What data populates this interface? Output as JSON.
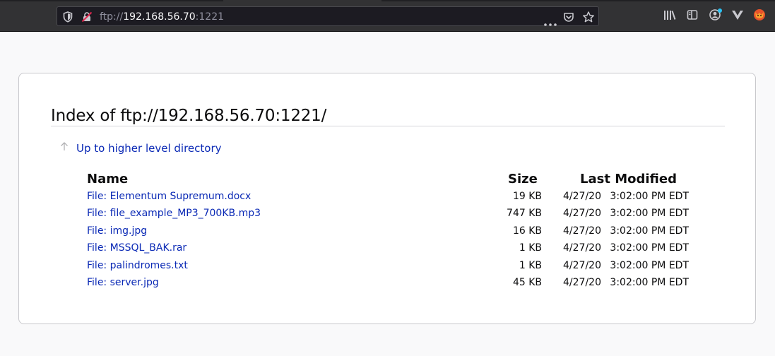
{
  "toolbar": {
    "url_scheme": "ftp://",
    "url_host": "192.168.56.70",
    "url_port": ":1221",
    "icons": [
      "shield-icon",
      "insecure-lock-icon",
      "page-actions-icon",
      "pocket-icon",
      "bookmark-star-icon",
      "library-icon",
      "sidebar-icon",
      "account-icon",
      "extension-v-icon",
      "fox-extension-icon"
    ],
    "colors": {
      "background": "#323234",
      "urlbar": "#1c1b22",
      "host_text": "#f9f9fa",
      "muted_text": "#8f8f9d"
    }
  },
  "page": {
    "title": "Index of ftp://192.168.56.70:1221/",
    "up_link": "Up to higher level directory",
    "columns": {
      "name": "Name",
      "size": "Size",
      "last_modified": "Last Modified"
    },
    "rows": [
      {
        "type": "File:",
        "name": "Elementum Supremum.docx",
        "size": "19 KB",
        "date": "4/27/20",
        "time": "3:02:00 PM EDT"
      },
      {
        "type": "File:",
        "name": "file_example_MP3_700KB.mp3",
        "size": "747 KB",
        "date": "4/27/20",
        "time": "3:02:00 PM EDT"
      },
      {
        "type": "File:",
        "name": "img.jpg",
        "size": "16 KB",
        "date": "4/27/20",
        "time": "3:02:00 PM EDT"
      },
      {
        "type": "File:",
        "name": "MSSQL_BAK.rar",
        "size": "1 KB",
        "date": "4/27/20",
        "time": "3:02:00 PM EDT"
      },
      {
        "type": "File:",
        "name": "palindromes.txt",
        "size": "1 KB",
        "date": "4/27/20",
        "time": "3:02:00 PM EDT"
      },
      {
        "type": "File:",
        "name": "server.jpg",
        "size": "45 KB",
        "date": "4/27/20",
        "time": "3:02:00 PM EDT"
      }
    ],
    "colors": {
      "link": "#0a29b5",
      "text": "#0c0c0d",
      "card_border": "#c8c8cc"
    }
  }
}
